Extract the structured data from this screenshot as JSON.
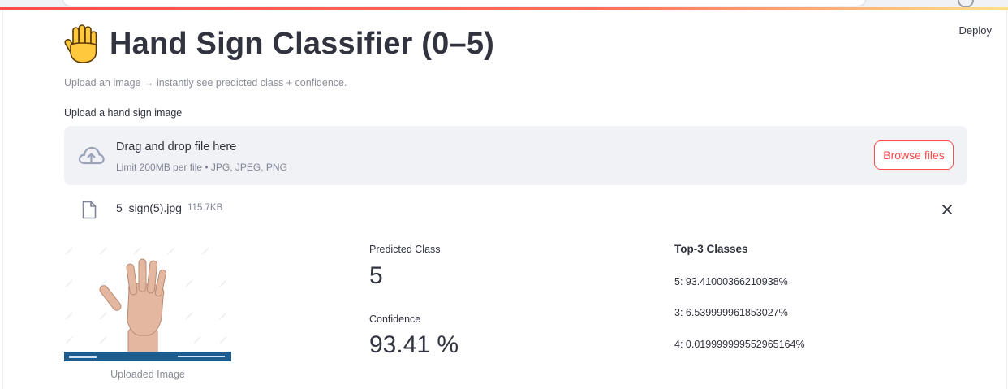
{
  "app": {
    "title": "Hand Sign Classifier (0–5)",
    "title_emoji": "raised-hand",
    "deploy_label": "Deploy",
    "subtitle": "Upload an image → instantly see predicted class + confidence.",
    "accent_color": "#ff4b4b"
  },
  "uploader": {
    "label": "Upload a hand sign image",
    "dropzone_title": "Drag and drop file here",
    "dropzone_hint": "Limit 200MB per file • JPG, JPEG, PNG",
    "browse_label": "Browse files",
    "icon": "cloud-upload-icon"
  },
  "file": {
    "name": "5_sign(5).jpg",
    "size": "115.7KB",
    "icon": "file-icon"
  },
  "image": {
    "caption": "Uploaded Image"
  },
  "prediction": {
    "class_label": "Predicted Class",
    "class_value": "5",
    "confidence_label": "Confidence",
    "confidence_value": "93.41 %"
  },
  "top3": {
    "title": "Top-3 Classes",
    "items": [
      "5: 93.41000366210938%",
      "3: 6.539999961853027%",
      "4: 0.019999999552965164%"
    ]
  }
}
